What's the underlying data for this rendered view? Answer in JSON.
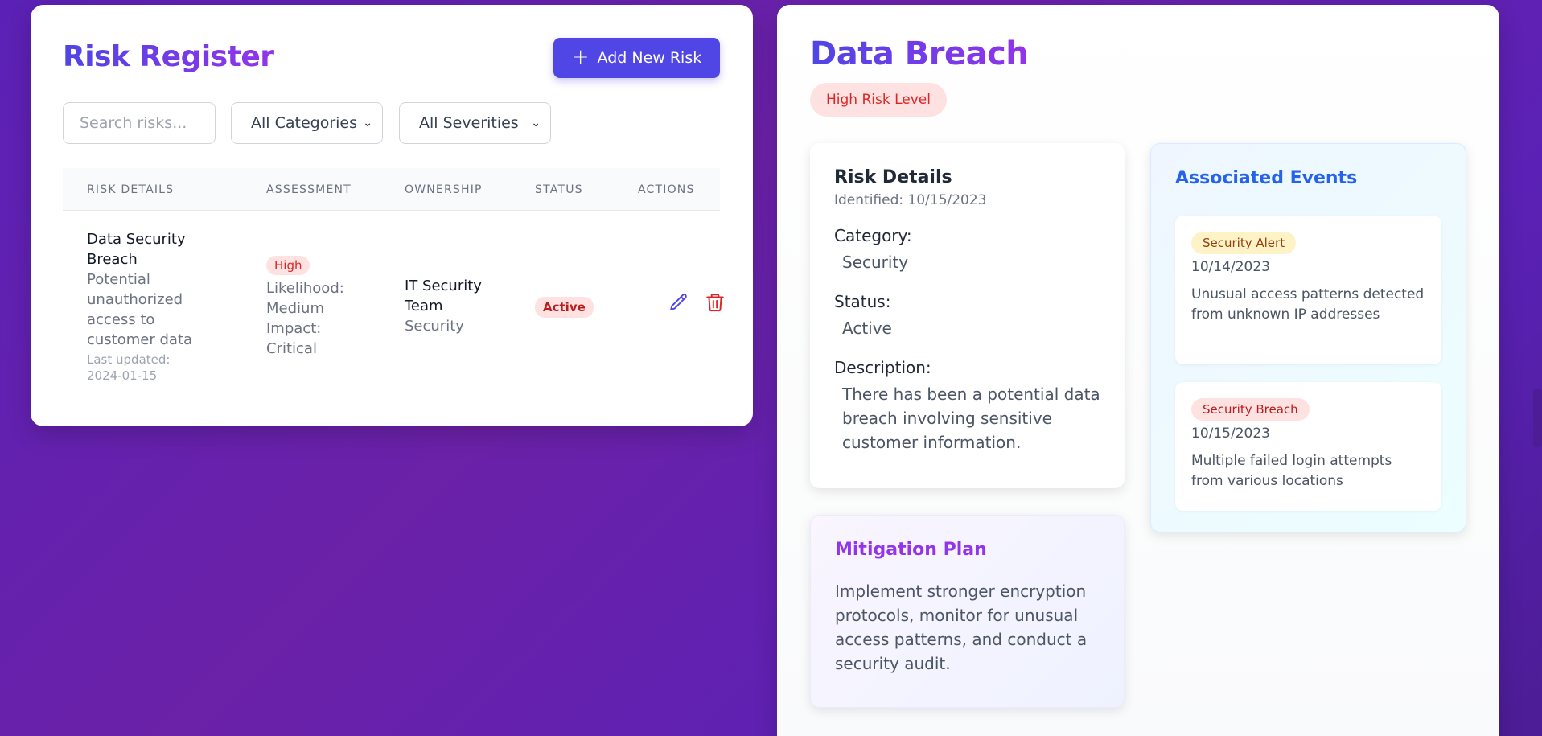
{
  "register": {
    "title": "Risk Register",
    "add_button_label": "Add New Risk",
    "search": {
      "placeholder": "Search risks...",
      "value": ""
    },
    "category_filter": {
      "selected": "All Categories"
    },
    "severity_filter": {
      "selected": "All Severities"
    },
    "columns": [
      "RISK DETAILS",
      "ASSESSMENT",
      "OWNERSHIP",
      "STATUS",
      "ACTIONS"
    ],
    "rows": [
      {
        "name": "Data Security Breach",
        "description": "Potential unauthorized access to customer data",
        "last_updated": "Last updated: 2024-01-15",
        "severity": "High",
        "likelihood": "Likelihood: Medium",
        "impact": "Impact: Critical",
        "owner": "IT Security Team",
        "department": "Security",
        "status": "Active"
      }
    ]
  },
  "detail": {
    "title": "Data Breach",
    "risk_level": "High Risk Level",
    "risk_details": {
      "heading": "Risk Details",
      "identified": "Identified: 10/15/2023",
      "category_label": "Category:",
      "category_value": "Security",
      "status_label": "Status:",
      "status_value": "Active",
      "description_label": "Description:",
      "description_value": "There has been a potential data breach involving sensitive customer information."
    },
    "events": {
      "heading": "Associated Events",
      "items": [
        {
          "type": "Security Alert",
          "date": "10/14/2023",
          "text": "Unusual access patterns detected from unknown IP addresses"
        },
        {
          "type": "Security Breach",
          "date": "10/15/2023",
          "text": "Multiple failed login attempts from various locations"
        }
      ]
    },
    "mitigation": {
      "heading": "Mitigation Plan",
      "text": "Implement stronger encryption protocols, monitor for unusual access patterns, and conduct a security audit."
    }
  },
  "colors": {
    "accent": "#4f46e5",
    "accent_secondary": "#9333ea",
    "danger": "#dc2626",
    "events_heading": "#2563eb",
    "background": "#5b21b6"
  }
}
